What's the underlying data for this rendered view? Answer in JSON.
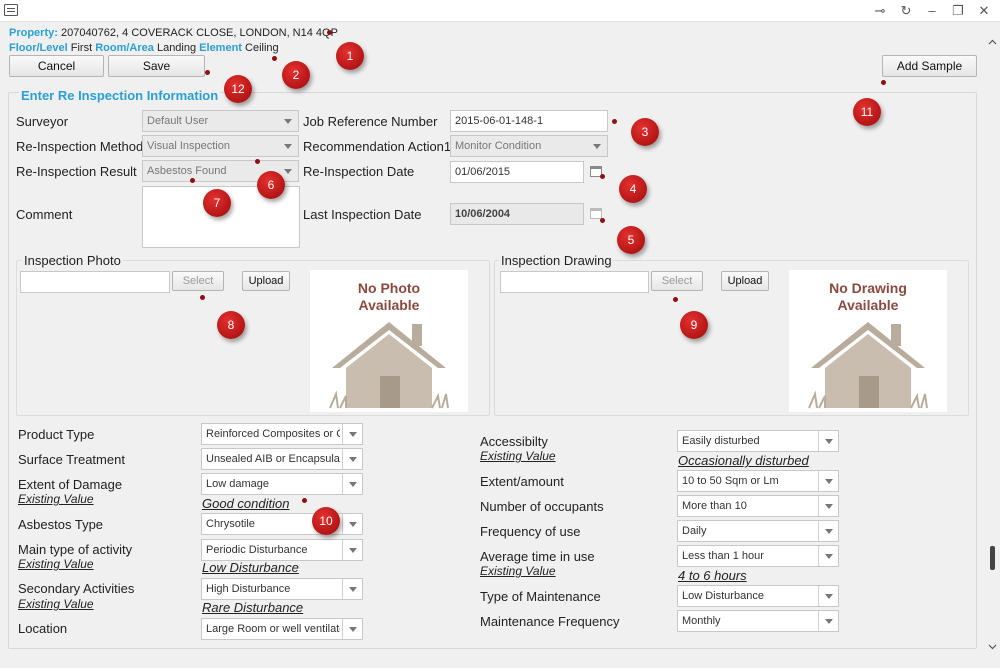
{
  "window": {
    "icons": {
      "app": "app-window-icon",
      "pin": "pin-icon",
      "refresh": "refresh-icon",
      "minimize": "minimize-icon",
      "restore": "restore-icon",
      "close": "close-icon"
    }
  },
  "header": {
    "property_label": "Property:",
    "property_value": "207040762, 4 COVERACK CLOSE, LONDON, N14 4QP",
    "floor_label": "Floor/Level",
    "floor_value": "First",
    "room_label": "Room/Area",
    "room_value": "Landing",
    "element_label": "Element",
    "element_value": "Ceiling"
  },
  "toolbar": {
    "cancel_label": "Cancel",
    "save_label": "Save",
    "add_sample_label": "Add Sample"
  },
  "form": {
    "section_title": "Enter Re Inspection Information",
    "surveyor_label": "Surveyor",
    "surveyor_value": "Default User",
    "method_label": "Re-Inspection Method",
    "method_value": "Visual Inspection",
    "result_label": "Re-Inspection Result",
    "result_value": "Asbestos Found",
    "comment_label": "Comment",
    "job_ref_label": "Job Reference Number",
    "job_ref_value": "2015-06-01-148-1",
    "rec_action_label": "Recommendation Action1",
    "rec_action_value": "Monitor Condition",
    "reinspection_date_label": "Re-Inspection Date",
    "reinspection_date_value": "01/06/2015",
    "last_inspection_label": "Last Inspection Date",
    "last_inspection_value": "10/06/2004"
  },
  "photo": {
    "title": "Inspection Photo",
    "select_label": "Select",
    "upload_label": "Upload",
    "placeholder_line1": "No Photo",
    "placeholder_line2": "Available"
  },
  "drawing": {
    "title": "Inspection Drawing",
    "select_label": "Select",
    "upload_label": "Upload",
    "placeholder_line1": "No Drawing",
    "placeholder_line2": "Available"
  },
  "assessment_left": [
    {
      "label": "Product Type",
      "value": "Reinforced Composites or Ce",
      "existing": ""
    },
    {
      "label": "Surface Treatment",
      "value": "Unsealed AIB or Encapsulate",
      "existing": ""
    },
    {
      "label": "Extent of Damage",
      "value": "Low damage",
      "existing": "Good condition"
    },
    {
      "label": "Asbestos Type",
      "value": "Chrysotile",
      "existing": ""
    },
    {
      "label": "Main type of activity",
      "value": "Periodic Disturbance",
      "existing": "Low Disturbance"
    },
    {
      "label": "Secondary Activities",
      "value": "High Disturbance",
      "existing": "Rare Disturbance"
    },
    {
      "label": "Location",
      "value": "Large Room or well ventilated",
      "existing": ""
    }
  ],
  "assessment_right": [
    {
      "label": "Accessibilty",
      "value": "Easily disturbed",
      "existing": "Occasionally disturbed"
    },
    {
      "label": "Extent/amount",
      "value": "10 to 50 Sqm or Lm",
      "existing": ""
    },
    {
      "label": "Number of occupants",
      "value": "More than 10",
      "existing": ""
    },
    {
      "label": "Frequency of use",
      "value": "Daily",
      "existing": ""
    },
    {
      "label": "Average time in use",
      "value": "Less than 1 hour",
      "existing": "4 to 6 hours"
    },
    {
      "label": "Type of Maintenance",
      "value": "Low Disturbance",
      "existing": ""
    },
    {
      "label": "Maintenance Frequency",
      "value": "Monthly",
      "existing": ""
    }
  ],
  "existing_value_label": "Existing Value",
  "annotations": [
    "1",
    "2",
    "3",
    "4",
    "5",
    "6",
    "7",
    "8",
    "9",
    "10",
    "11",
    "12"
  ],
  "colors": {
    "accent": "#2a9fd6",
    "badge": "#c01818",
    "placeholder_text": "#8a4a3e"
  }
}
